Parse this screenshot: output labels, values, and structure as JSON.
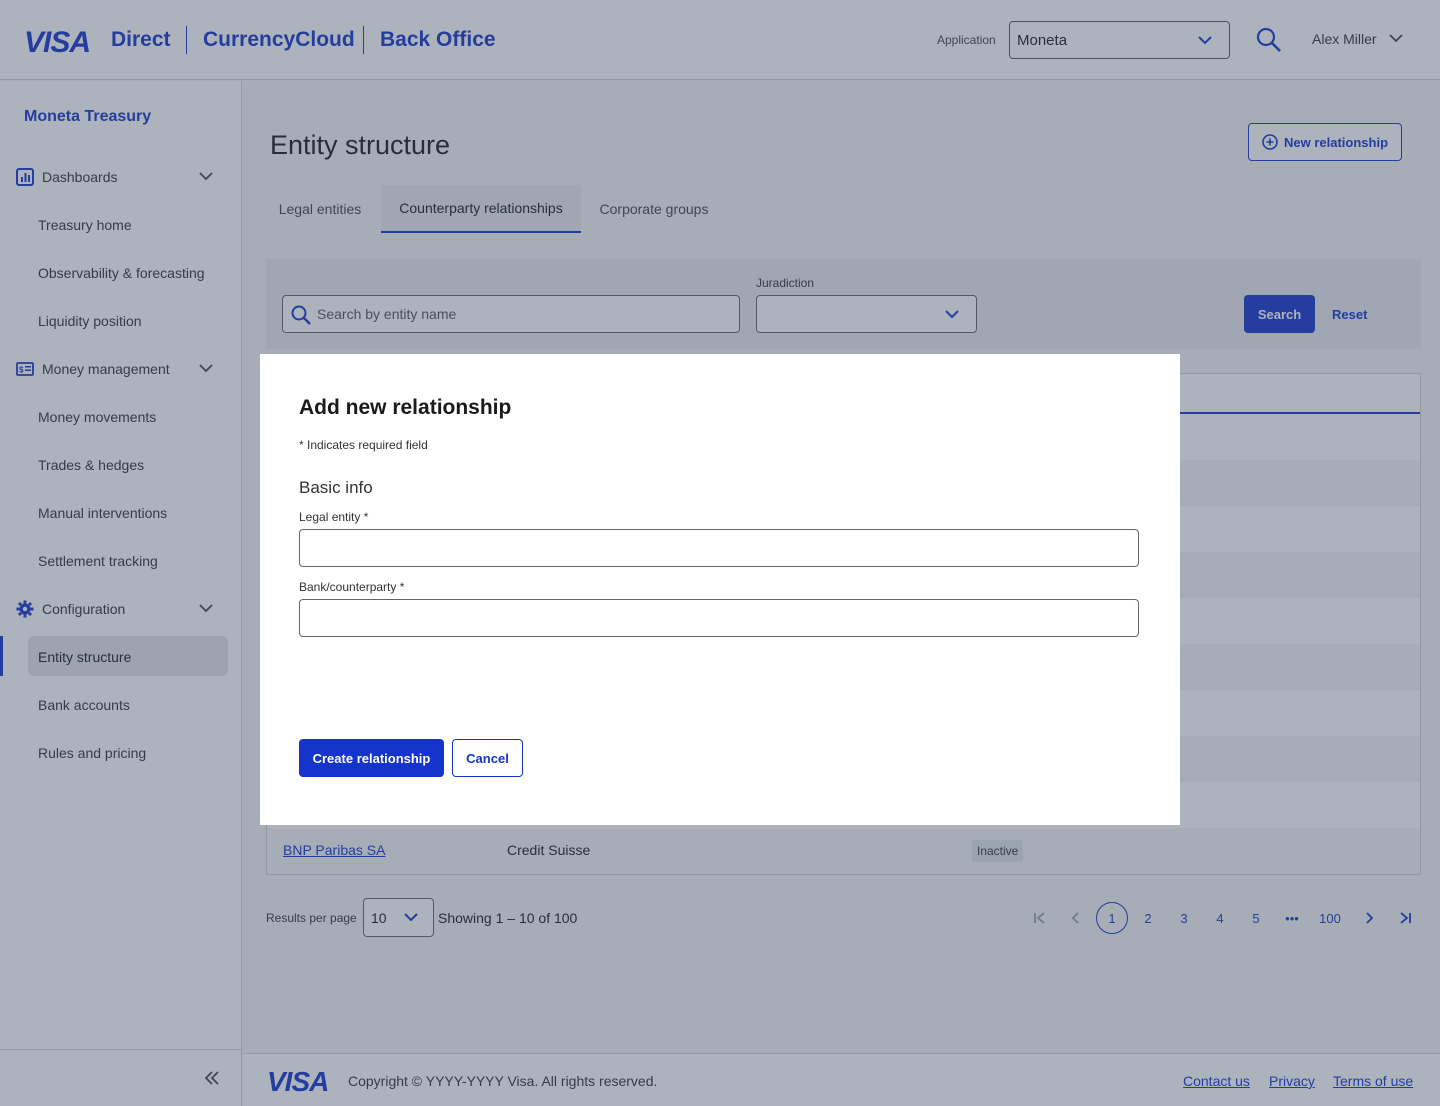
{
  "header": {
    "logo": "VISA",
    "brand_parts": [
      "Direct",
      "CurrencyCloud",
      "Back Office"
    ],
    "application_label": "Application",
    "application_value": "Moneta",
    "user_name": "Alex Miller"
  },
  "sidebar": {
    "org_name": "Moneta Treasury",
    "sections": [
      {
        "label": "Dashboards",
        "icon": "dashboard-icon",
        "items": [
          "Treasury home",
          "Observability & forecasting",
          "Liquidity position"
        ]
      },
      {
        "label": "Money management",
        "icon": "money-icon",
        "items": [
          "Money movements",
          "Trades & hedges",
          "Manual interventions",
          "Settlement tracking"
        ]
      },
      {
        "label": "Configuration",
        "icon": "gear-icon",
        "items": [
          "Entity structure",
          "Bank accounts",
          "Rules and pricing"
        ]
      }
    ],
    "active_item": "Entity structure"
  },
  "main": {
    "page_title": "Entity structure",
    "new_button": "New relationship",
    "tabs": [
      "Legal entities",
      "Counterparty relationships",
      "Corporate groups"
    ],
    "active_tab": "Counterparty relationships",
    "filters": {
      "search_placeholder": "Search by entity name",
      "jurisdiction_label": "Juradiction",
      "jurisdiction_value": "",
      "search_button": "Search",
      "reset_link": "Reset"
    },
    "table": {
      "visible_row": {
        "legal_entity": "BNP Paribas SA",
        "counterparty": "Credit Suisse",
        "status": "Inactive"
      }
    },
    "pagination": {
      "results_label": "Results per page",
      "per_page": "10",
      "showing": "Showing 1 – 10 of 100",
      "pages": [
        "1",
        "2",
        "3",
        "4",
        "5",
        "•••",
        "100"
      ],
      "current_page": "1"
    }
  },
  "footer": {
    "logo": "VISA",
    "copyright": "Copyright © YYYY-YYYY Visa. All rights reserved.",
    "links": [
      "Contact us",
      "Privacy",
      "Terms of use"
    ]
  },
  "modal": {
    "title": "Add new relationship",
    "required_note": "* Indicates required field",
    "section_title": "Basic info",
    "fields": [
      {
        "label": "Legal entity *",
        "value": ""
      },
      {
        "label": "Bank/counterparty *",
        "value": ""
      }
    ],
    "primary_button": "Create relationship",
    "secondary_button": "Cancel"
  },
  "colors": {
    "brand_blue": "#1434cb",
    "overlay": "#3c4a60"
  }
}
